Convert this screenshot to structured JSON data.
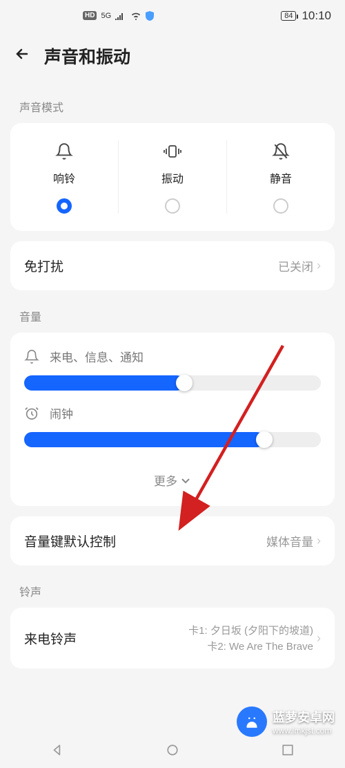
{
  "statusBar": {
    "hd": "HD",
    "network": "5G",
    "battery": "84",
    "time": "10:10"
  },
  "header": {
    "title": "声音和振动"
  },
  "soundMode": {
    "sectionLabel": "声音模式",
    "ring": "响铃",
    "vibrate": "振动",
    "silent": "静音"
  },
  "dnd": {
    "title": "免打扰",
    "value": "已关闭"
  },
  "volume": {
    "sectionLabel": "音量",
    "calls": "来电、信息、通知",
    "alarm": "闹钟",
    "more": "更多"
  },
  "volumeKey": {
    "title": "音量键默认控制",
    "value": "媒体音量"
  },
  "ringtone": {
    "sectionLabel": "铃声",
    "title": "来电铃声",
    "sim1": "卡1: 夕日坂 (夕阳下的坡道)",
    "sim2": "卡2: We Are The Brave"
  },
  "watermark": {
    "title": "蓝萝安卓网",
    "url": "www.lmkjst.com"
  }
}
